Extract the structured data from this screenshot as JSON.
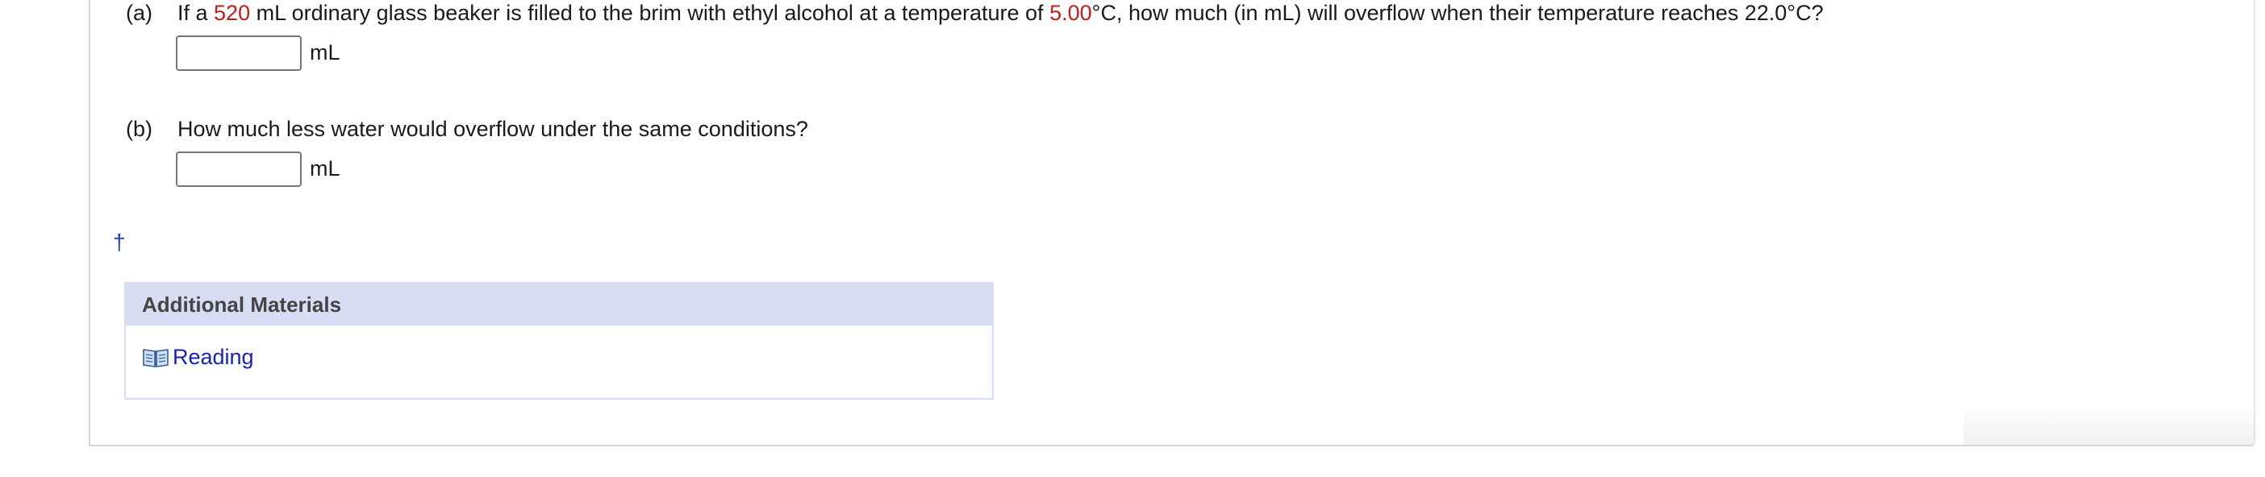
{
  "question_a": {
    "part_label": "(a)",
    "text_before_volume": "If a ",
    "volume": "520",
    "text_after_volume": " mL ordinary glass beaker is filled to the brim with ethyl alcohol at a temperature of ",
    "initial_temp": "5.00",
    "text_after_temp": "°C, how much (in mL) will overflow when their temperature reaches 22.0°C?",
    "input_value": "",
    "unit": "mL"
  },
  "question_b": {
    "part_label": "(b)",
    "text": "How much less water would overflow under the same conditions?",
    "input_value": "",
    "unit": "mL"
  },
  "footnote_marker": "†",
  "additional_materials": {
    "header": "Additional Materials",
    "link_label": "Reading",
    "link_icon": "book-icon"
  },
  "colors": {
    "highlight_red": "#c21d1d",
    "link_blue": "#1a21b8",
    "panel_header_bg": "#d7ddf3"
  }
}
